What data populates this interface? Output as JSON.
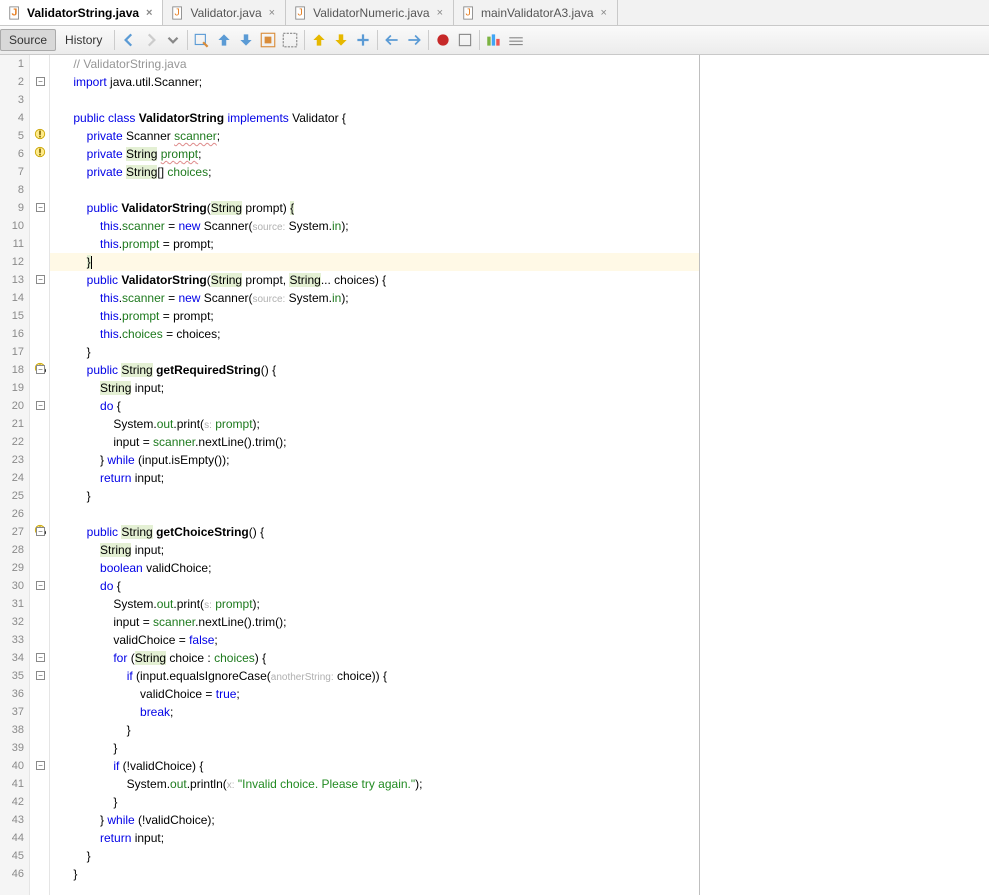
{
  "tabs": [
    {
      "name": "ValidatorString.java",
      "active": true
    },
    {
      "name": "Validator.java",
      "active": false
    },
    {
      "name": "ValidatorNumeric.java",
      "active": false
    },
    {
      "name": "mainValidatorA3.java",
      "active": false
    }
  ],
  "toolbar": {
    "source": "Source",
    "history": "History"
  },
  "lines": [
    {
      "n": 1,
      "html": "    <span class='com'>// ValidatorString.java</span>"
    },
    {
      "n": 2,
      "html": "    <span class='kw'>import</span> java.util.Scanner;",
      "fold": "-"
    },
    {
      "n": 3,
      "html": ""
    },
    {
      "n": 4,
      "html": "    <span class='kw'>public</span> <span class='kw'>class</span> <span class='bold'>ValidatorString</span> <span class='kw'>implements</span> Validator {"
    },
    {
      "n": 5,
      "html": "        <span class='kw'>private</span> Scanner <span class='fld decl'>scanner</span>;",
      "glyph": "warn"
    },
    {
      "n": 6,
      "html": "        <span class='kw'>private</span> <span class='htype'>String</span> <span class='fld decl'>prompt</span>;",
      "glyph": "warn"
    },
    {
      "n": 7,
      "html": "        <span class='kw'>private</span> <span class='htype'>String</span>[] <span class='fld'>choices</span>;"
    },
    {
      "n": 8,
      "html": ""
    },
    {
      "n": 9,
      "html": "        <span class='kw'>public</span> <span class='bold'>ValidatorString</span>(<span class='htype'>String</span> prompt) <span class='hbrace'>{</span>",
      "fold": "-"
    },
    {
      "n": 10,
      "html": "            <span class='kw'>this</span>.<span class='fld'>scanner</span> = <span class='kw'>new</span> Scanner(<span class='hint'>source:</span> System.<span class='fld'>in</span>);"
    },
    {
      "n": 11,
      "html": "            <span class='kw'>this</span>.<span class='fld'>prompt</span> = prompt;"
    },
    {
      "n": 12,
      "html": "        <span class='hbrace'>}</span><span class='cursor'></span>",
      "hl": true
    },
    {
      "n": 13,
      "html": "        <span class='kw'>public</span> <span class='bold'>ValidatorString</span>(<span class='htype'>String</span> prompt, <span class='htype'>String</span>... choices) {",
      "fold": "-"
    },
    {
      "n": 14,
      "html": "            <span class='kw'>this</span>.<span class='fld'>scanner</span> = <span class='kw'>new</span> Scanner(<span class='hint'>source:</span> System.<span class='fld'>in</span>);"
    },
    {
      "n": 15,
      "html": "            <span class='kw'>this</span>.<span class='fld'>prompt</span> = prompt;"
    },
    {
      "n": 16,
      "html": "            <span class='kw'>this</span>.<span class='fld'>choices</span> = choices;"
    },
    {
      "n": 17,
      "html": "        }"
    },
    {
      "n": 18,
      "html": "        <span class='kw'>public</span> <span class='htype'>String</span> <span class='bold'>getRequiredString</span>() {",
      "fold": "-",
      "glyph": "warn-imp"
    },
    {
      "n": 19,
      "html": "            <span class='htype'>String</span> input;"
    },
    {
      "n": 20,
      "html": "            <span class='kw'>do</span> {",
      "fold": "-"
    },
    {
      "n": 21,
      "html": "                System.<span class='fld'>out</span>.print(<span class='hint'>s:</span> <span class='fld'>prompt</span>);"
    },
    {
      "n": 22,
      "html": "                input = <span class='fld'>scanner</span>.nextLine().trim();"
    },
    {
      "n": 23,
      "html": "            } <span class='kw'>while</span> (input.isEmpty());"
    },
    {
      "n": 24,
      "html": "            <span class='kw'>return</span> input;"
    },
    {
      "n": 25,
      "html": "        }"
    },
    {
      "n": 26,
      "html": ""
    },
    {
      "n": 27,
      "html": "        <span class='kw'>public</span> <span class='htype'>String</span> <span class='bold'>getChoiceString</span>() {",
      "fold": "-",
      "glyph": "warn-imp"
    },
    {
      "n": 28,
      "html": "            <span class='htype'>String</span> input;"
    },
    {
      "n": 29,
      "html": "            <span class='kw'>boolean</span> validChoice;"
    },
    {
      "n": 30,
      "html": "            <span class='kw'>do</span> {",
      "fold": "-"
    },
    {
      "n": 31,
      "html": "                System.<span class='fld'>out</span>.print(<span class='hint'>s:</span> <span class='fld'>prompt</span>);"
    },
    {
      "n": 32,
      "html": "                input = <span class='fld'>scanner</span>.nextLine().trim();"
    },
    {
      "n": 33,
      "html": "                validChoice = <span class='kw'>false</span>;"
    },
    {
      "n": 34,
      "html": "                <span class='kw'>for</span> (<span class='htype'>String</span> choice : <span class='fld'>choices</span>) {",
      "fold": "-"
    },
    {
      "n": 35,
      "html": "                    <span class='kw'>if</span> (input.equalsIgnoreCase(<span class='hint'>anotherString:</span> choice)) {",
      "fold": "-"
    },
    {
      "n": 36,
      "html": "                        validChoice = <span class='kw'>true</span>;"
    },
    {
      "n": 37,
      "html": "                        <span class='kw'>break</span>;"
    },
    {
      "n": 38,
      "html": "                    }"
    },
    {
      "n": 39,
      "html": "                }"
    },
    {
      "n": 40,
      "html": "                <span class='kw'>if</span> (!validChoice) {",
      "fold": "-"
    },
    {
      "n": 41,
      "html": "                    System.<span class='fld'>out</span>.println(<span class='hint'>x:</span> <span class='strg'>\"Invalid choice. Please try again.\"</span>);"
    },
    {
      "n": 42,
      "html": "                }"
    },
    {
      "n": 43,
      "html": "            } <span class='kw'>while</span> (!validChoice);"
    },
    {
      "n": 44,
      "html": "            <span class='kw'>return</span> input;"
    },
    {
      "n": 45,
      "html": "        }"
    },
    {
      "n": 46,
      "html": "    }"
    }
  ]
}
